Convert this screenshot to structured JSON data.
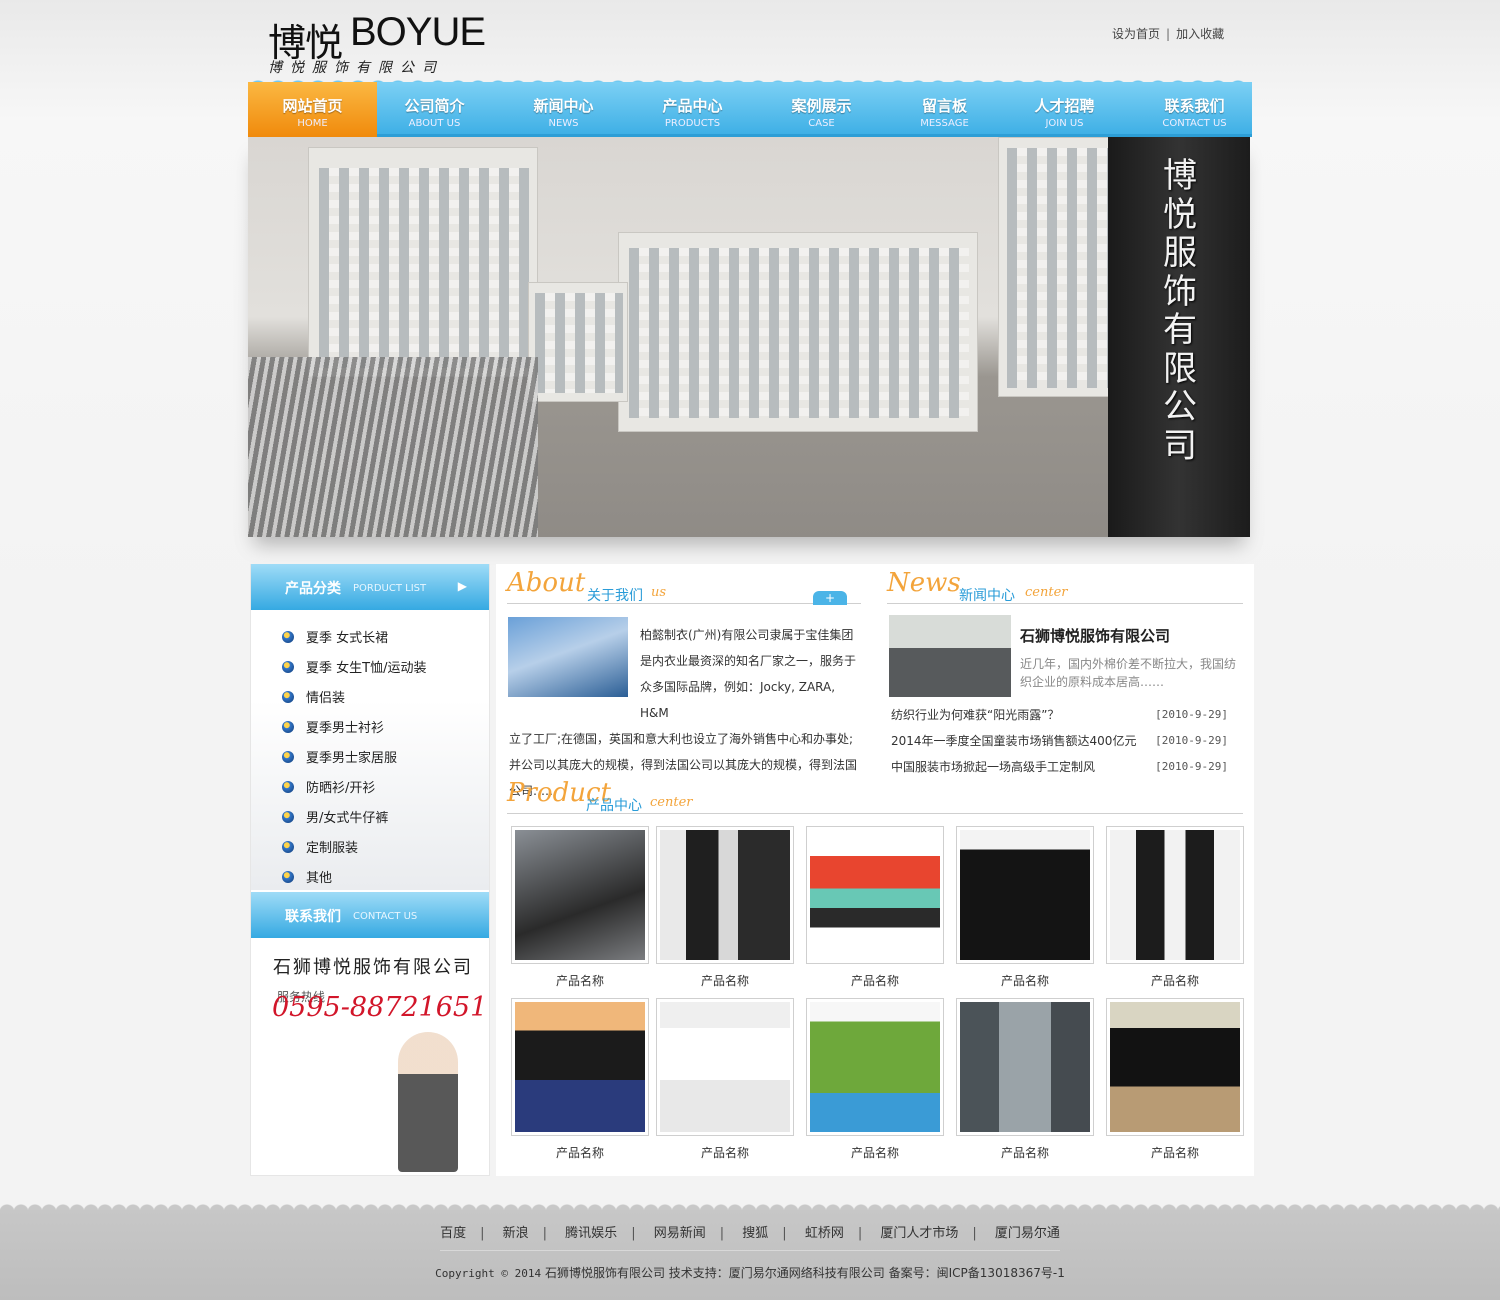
{
  "header": {
    "logo_cn": "博悦",
    "logo_en": "BOYUE",
    "logo_sub": "博悦服饰有限公司",
    "top_links": [
      "设为首页",
      "加入收藏"
    ]
  },
  "nav": [
    {
      "cn": "网站首页",
      "en": "HOME",
      "active": true
    },
    {
      "cn": "公司简介",
      "en": "ABOUT US"
    },
    {
      "cn": "新闻中心",
      "en": "NEWS"
    },
    {
      "cn": "产品中心",
      "en": "PRODUCTS"
    },
    {
      "cn": "案例展示",
      "en": "CASE"
    },
    {
      "cn": "留言板",
      "en": "MESSAGE"
    },
    {
      "cn": "人才招聘",
      "en": "JOIN US"
    },
    {
      "cn": "联系我们",
      "en": "CONTACT US"
    }
  ],
  "banner": {
    "sign_text": "博悦服饰有限公司"
  },
  "sidebar": {
    "products_title": {
      "cn": "产品分类",
      "en": "PORDUCT LIST",
      "arrow": "▶"
    },
    "categories": [
      "夏季 女式长裙",
      "夏季 女生T恤/运动装",
      "情侣装",
      "夏季男士衬衫",
      "夏季男士家居服",
      "防晒衫/开衫",
      "男/女式牛仔裤",
      "定制服装",
      "其他"
    ],
    "contact_title": {
      "cn": "联系我们",
      "en": "CONTACT US"
    },
    "company": "石狮博悦服饰有限公司",
    "hotline_label": "服务热线",
    "phone": "0595-88721651"
  },
  "about": {
    "big": "About",
    "cn": "关于我们",
    "en": "us",
    "plus": "+",
    "text_lines": [
      "柏懿制衣(广州)有限公司隶属于宝佳集团",
      "是内衣业最资深的知名厂家之一，服务于",
      "众多国际品牌，例如：Jocky, ZARA, H&M",
      "立了工厂;在德国，英国和意大利也设立了海外销售中心和办事处;",
      "并公司以其庞大的规模，得到法国公司以其庞大的规模，得到法国",
      "公司……"
    ]
  },
  "news": {
    "big": "News",
    "cn": "新闻中心",
    "en": "center",
    "headline": "石狮博悦服饰有限公司",
    "lead": "近几年，国内外棉价差不断拉大，我国纺织企业的原料成本居高……",
    "items": [
      {
        "title": "纺织行业为何难获“阳光雨露”？",
        "date": "[2010-9-29]"
      },
      {
        "title": "2014年一季度全国童装市场销售额达400亿元",
        "date": "[2010-9-29]"
      },
      {
        "title": "中国服装市场掀起一场高级手工定制风",
        "date": "[2010-9-29]"
      }
    ]
  },
  "products": {
    "big": "Product",
    "cn": "产品中心",
    "en": "center",
    "items": [
      "产品名称",
      "产品名称",
      "产品名称",
      "产品名称",
      "产品名称",
      "产品名称",
      "产品名称",
      "产品名称",
      "产品名称",
      "产品名称"
    ]
  },
  "footer": {
    "links": [
      "百度",
      "新浪",
      "腾讯娱乐",
      "网易新闻",
      "搜狐",
      "虹桥网",
      "厦门人才市场",
      "厦门易尔通"
    ],
    "copyright_prefix": "Copyright © 2014",
    "copyright_company": "石狮博悦服饰有限公司",
    "support": "技术支持：厦门易尔通网络科技有限公司",
    "icp": "备案号：闽ICP备13018367号-1"
  },
  "colors": {
    "nav_blue": "#3fb0e6",
    "nav_active": "#f08a0c",
    "accent_orange": "#f3a43b",
    "title_blue": "#2a9cd8",
    "phone_red": "#d2162a"
  }
}
